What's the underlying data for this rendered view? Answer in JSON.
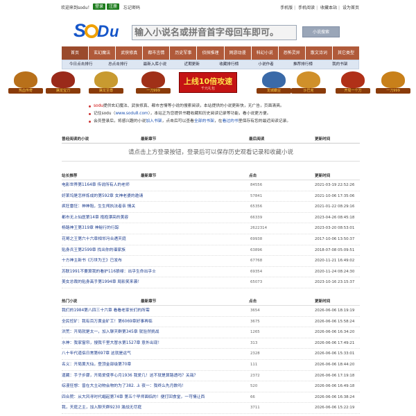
{
  "topbar": {
    "welcome": "欢迎来到sodu！",
    "login": "登录",
    "register": "注册",
    "forgot": "忘记密码",
    "links": [
      "手机版",
      "手机阅读",
      "收藏本站",
      "设为首页"
    ]
  },
  "search": {
    "placeholder": "输入小说名或拼音首字母回车即可。",
    "button": "小说搜索"
  },
  "nav": [
    "首页",
    "玄幻魔法",
    "武侠修真",
    "都市言情",
    "历史军事",
    "侦探推理",
    "网游动漫",
    "科幻小说",
    "恐怖灵异",
    "散文诗词",
    "其它类型"
  ],
  "subnav": [
    "今日点击排行",
    "总点击排行",
    "最新入库小说",
    "近期更新",
    "收藏排行榜",
    "小说作者",
    "推荐排行榜",
    "我的书架"
  ],
  "banners": [
    "热血传奇",
    "屠龙宝刀",
    "屠龙至尊",
    "一刀999",
    "上线10倍攻速",
    "千元礼包",
    "龙城霸业",
    "沙巴克",
    "开局一个刀",
    "一刀999"
  ],
  "tips": [
    {
      "a": "sodu",
      "b": "提供玄幻魔法、武侠修真、都市言情等小说的搜索阅读，本站提供的小说更新快，无广告，页面清爽。"
    },
    {
      "a": "记住sodu（",
      "b": "www.sodu8.com",
      "c": "），本站正为您提供书籍收藏和历史阅读记录等功能，看小说更方便。"
    },
    {
      "a": "会员登录后，将感兴趣的小说",
      "b": "加入书架",
      "c": "，点击后可以查看",
      "d": "全部的书架",
      "e": "，在",
      "f": "看过的书",
      "g": "里保存有您的最近阅读记录。"
    }
  ],
  "history": {
    "headers": [
      "曾经阅读的小说",
      "最新章节",
      "最后阅读",
      "更新时间"
    ],
    "message": "请点击上方登录按钮，登录后可以保存历史观看记录和收藏小说"
  },
  "recommend": {
    "headers": [
      "站长推荐",
      "最新章节",
      "点击",
      "更新时间"
    ],
    "rows": [
      [
        "电影世界",
        "第1164章 传说所有人的老师",
        "84556",
        "2021-03-19 22:52:26"
      ],
      [
        "好莱坞是怎样炼成的",
        "第592章 女神老婆的邀请",
        "57841",
        "2021-10-06 17:35:06"
      ],
      [
        "疯狂雷狂：神神阻，生生闯",
        "执法者亲 情关",
        "65356",
        "2021-01-22 08:29:16"
      ],
      [
        "都市无上仙医",
        "第14章 抱抱漂亮的美容",
        "66339",
        "2023-04-26 08:45:18"
      ],
      [
        "杨路神王",
        "第319章 神秘行的行踪",
        "2622314",
        "2023-03-20 08:53:01"
      ],
      [
        "花哥之王",
        "第六十六章相邻冯合遇天庭",
        "69938",
        "2017-10-06 13:50:37"
      ],
      [
        "贴身兵王",
        "第2599章 找出你的谱家族",
        "63896",
        "2018-07-08 05:09:51"
      ],
      [
        "十方神主",
        "新书《万世为王》已发布",
        "67768",
        "2020-11-21 16:49:02"
      ],
      [
        "苏联1991",
        "不要算我的看护116狼禄：出乎生命出乎士",
        "69354",
        "2020-11-24 08:24:30"
      ],
      [
        "美女总裁的贴身高手",
        "第1994章 局影笑来袭！",
        "65073",
        "2023-10-16 23:15:37"
      ]
    ]
  },
  "hot": {
    "headers": [
      "热门小说",
      "最新章节",
      "点击",
      "更新时间"
    ],
    "rows": [
      [
        "我们的1984",
        "第八四三十六章 看看老家长们的所需",
        "3654",
        "2026-06-06 18:19:19"
      ],
      [
        "全民挖矿：我有百万黄金矿工！",
        "第6069章好事再临",
        "3675",
        "2026-06-06 15:58:24"
      ],
      [
        "洪荒：开局就是太一，加入聊天群",
        "第345章 就验然挑战",
        "1265",
        "2026-06-06 16:34:20"
      ],
      [
        "水神：我家窗帘，搜我千里大冒水",
        "第1527章 意外出现！",
        "313",
        "2026-06-06 17:49:21"
      ],
      [
        "八十年代道侣日常",
        "第697章 这就是运气",
        "2328",
        "2026-06-06 15:33:01"
      ],
      [
        "名义：开局黄大仙，登顶金部级",
        "第70章",
        "111",
        "2026-06-06 18:44:20"
      ],
      [
        "道藏：手子步骤，开局爱使李心月",
        "1936 我爱几！这不就是算路透吗？关哉？",
        "2372",
        "2026-06-06 17:19:18"
      ],
      [
        "综漫狂想：曾在大主动物会物的为了",
        "382. 上 夜一：我终么先月数吗！",
        "520",
        "2026-06-06 16:49:18"
      ],
      [
        "四合院：从大风寻时代崛起",
        "第74章 第五个早师面临的！便打回食堂，一可情让西",
        "66",
        "2026-06-06 16:38:24"
      ],
      [
        "我，天庭之主，加入聊天群",
        "9230 激战无尽庭",
        "3711",
        "2026-06-06 15:22:19"
      ]
    ]
  },
  "colors": {
    "nav": "#b05a3a",
    "accent": "#1e7d1e",
    "banner": "#c41414"
  }
}
